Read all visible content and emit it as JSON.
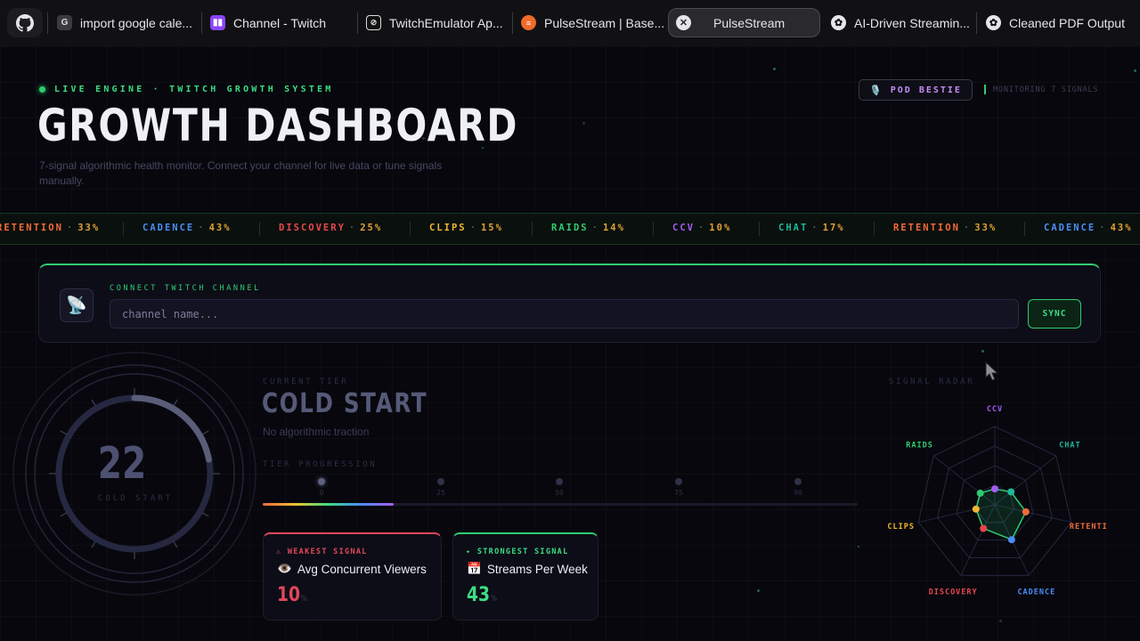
{
  "tabs": [
    {
      "label": "import google cale...",
      "icon": "google-icon"
    },
    {
      "label": "Channel - Twitch",
      "icon": "twitch-icon"
    },
    {
      "label": "TwitchEmulator Ap...",
      "icon": "app-icon"
    },
    {
      "label": "PulseStream | Base...",
      "icon": "pulsestream-icon"
    },
    {
      "label": "PulseStream",
      "icon": "close-icon",
      "active": true
    },
    {
      "label": "AI-Driven Streamin...",
      "icon": "openai-icon"
    },
    {
      "label": "Cleaned PDF Output",
      "icon": "openai-icon"
    }
  ],
  "header": {
    "eyebrow": "LIVE ENGINE · TWITCH GROWTH SYSTEM",
    "title": "GROWTH DASHBOARD",
    "subtitle": "7-signal algorithmic health monitor. Connect your channel for live data or tune signals manually.",
    "badge": "POD BESTIE",
    "monitoring": "MONITORING 7 SIGNALS"
  },
  "ticker": [
    {
      "name": "RETENTION",
      "value": "33%",
      "color": "#f26b3a"
    },
    {
      "name": "CADENCE",
      "value": "43%",
      "color": "#4a8df7"
    },
    {
      "name": "DISCOVERY",
      "value": "25%",
      "color": "#e8474f"
    },
    {
      "name": "CLIPS",
      "value": "15%",
      "color": "#f2b630"
    },
    {
      "name": "RAIDS",
      "value": "14%",
      "color": "#2ecc71"
    },
    {
      "name": "CCV",
      "value": "10%",
      "color": "#a35cf0"
    },
    {
      "name": "CHAT",
      "value": "17%",
      "color": "#1fb89a"
    },
    {
      "name": "RETENTION",
      "value": "33%",
      "color": "#f26b3a"
    },
    {
      "name": "CADENCE",
      "value": "43%",
      "color": "#4a8df7"
    }
  ],
  "connect": {
    "label": "CONNECT TWITCH CHANNEL",
    "placeholder": "channel name...",
    "value": "",
    "button": "SYNC"
  },
  "gauge": {
    "score": "22",
    "tier": "COLD START",
    "fraction": 0.22
  },
  "tier": {
    "label": "CURRENT TIER",
    "name": "COLD START",
    "description": "No algorithmic traction",
    "progression_label": "TIER PROGRESSION",
    "markers": [
      "0",
      "25",
      "50",
      "75",
      "90"
    ],
    "progress_fraction": 0.22
  },
  "weakest": {
    "label": "⚠ WEAKEST SIGNAL",
    "emoji": "👁️",
    "name": "Avg Concurrent Viewers",
    "value": "10",
    "unit": "%"
  },
  "strongest": {
    "label": "✦ STRONGEST SIGNAL",
    "emoji": "📅",
    "name": "Streams Per Week",
    "value": "43",
    "unit": "%"
  },
  "radar": {
    "label": "SIGNAL RADAR",
    "axes": [
      {
        "name": "CCV",
        "value": 10,
        "color": "#a35cf0"
      },
      {
        "name": "CHAT",
        "value": 17,
        "color": "#1fb89a"
      },
      {
        "name": "RETENTI",
        "value": 33,
        "color": "#f26b3a"
      },
      {
        "name": "CADENCE",
        "value": 43,
        "color": "#4a8df7"
      },
      {
        "name": "DISCOVERY",
        "value": 25,
        "color": "#e8474f"
      },
      {
        "name": "CLIPS",
        "value": 15,
        "color": "#f2b630"
      },
      {
        "name": "RAIDS",
        "value": 14,
        "color": "#2ecc71"
      }
    ]
  }
}
